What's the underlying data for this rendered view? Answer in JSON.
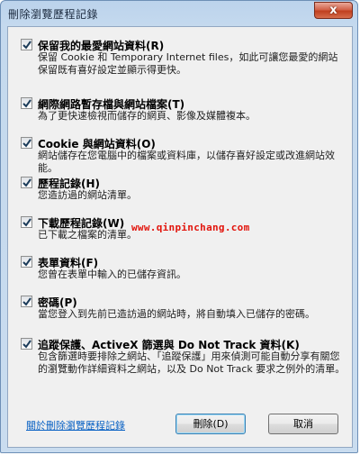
{
  "window": {
    "title": "刪除瀏覽歷程記錄",
    "close_label": "x"
  },
  "options": [
    {
      "checked": true,
      "title": "保留我的最愛網站資料(R)",
      "desc": "保留 Cookie 和 Temporary Internet files，如此可讓您最愛的網站保留既有喜好設定並顯示得更快。"
    },
    {
      "checked": true,
      "title": "網際網路暫存檔與網站檔案(T)",
      "desc": "為了更快速檢視而儲存的網頁、影像及媒體複本。"
    },
    {
      "checked": true,
      "title": "Cookie 與網站資料(O)",
      "desc": "網站儲存在您電腦中的檔案或資料庫，以儲存喜好設定或改進網站效能。"
    },
    {
      "checked": true,
      "title": "歷程記錄(H)",
      "desc": "您造訪過的網站清單。"
    },
    {
      "checked": true,
      "title": "下載歷程記錄(W)",
      "desc": "已下載之檔案的清單。"
    },
    {
      "checked": true,
      "title": "表單資料(F)",
      "desc": "您曾在表單中輸入的已儲存資訊。"
    },
    {
      "checked": true,
      "title": "密碼(P)",
      "desc": "當您登入到先前已造訪過的網站時，將自動填入已儲存的密碼。"
    },
    {
      "checked": true,
      "title": "追蹤保護、ActiveX 篩選與 Do Not Track 資料(K)",
      "desc": "包含篩選時要排除之網站、「追蹤保護」用來偵測可能自動分享有關您的瀏覽動作詳細資料之網站，以及 Do Not Track 要求之例外的清單。"
    }
  ],
  "watermark": "www.qinpinchang.com",
  "footer": {
    "link_label": "關於刪除瀏覽歷程記錄",
    "delete_label": "刪除(D)",
    "cancel_label": "取消"
  }
}
